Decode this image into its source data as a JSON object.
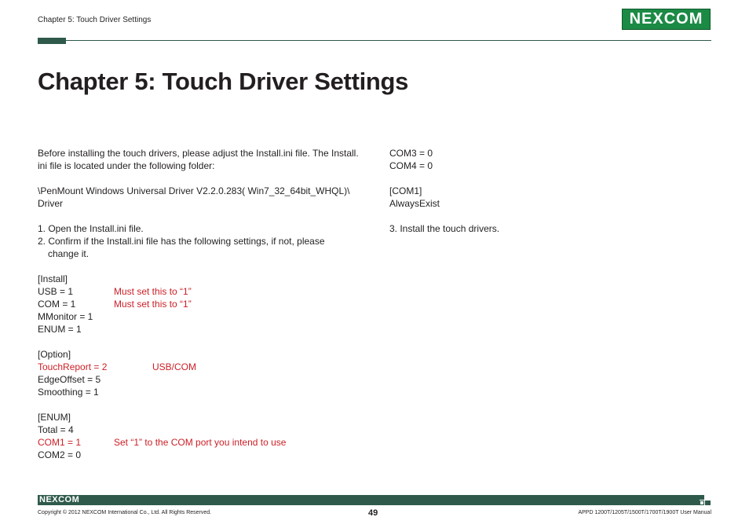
{
  "header": {
    "chapter_label": "Chapter 5: Touch Driver Settings",
    "logo_text": "NEXCOM",
    "brand_green": "#1b8a45",
    "rule_color": "#2f5a4b"
  },
  "title": "Chapter 5: Touch Driver Settings",
  "left": {
    "intro_1": "Before installing the touch drivers, please adjust the Install.ini file. The Install.",
    "intro_2": "ini file is located under the following folder:",
    "path_1": "\\PenMount Windows Universal Driver V2.2.0.283( Win7_32_64bit_WHQL)\\",
    "path_2": "Driver",
    "step_1": "1. Open the Install.ini file.",
    "step_2a": "2. Confirm if the Install.ini file has the following settings, if not, please",
    "step_2b": "change it.",
    "install_header": "[Install]",
    "usb_key": "USB = 1",
    "usb_note": "Must set this to “1”",
    "com_key": "COM = 1",
    "com_note": "Must set this to “1”",
    "mmonitor": "MMonitor = 1",
    "enum_val": "ENUM = 1",
    "option_header": "[Option]",
    "touchreport_key": "TouchReport = 2",
    "touchreport_note": "USB/COM",
    "edgeoffset": "EdgeOffset = 5",
    "smoothing": "Smoothing = 1",
    "enum_header": "[ENUM]",
    "total": "Total = 4",
    "com1_key": "COM1 = 1",
    "com1_note": "Set “1” to the COM port you intend to use",
    "com2": "COM2 = 0"
  },
  "right": {
    "com3": "COM3 = 0",
    "com4": "COM4 = 0",
    "com1_header": "[COM1]",
    "alwaysexist": "AlwaysExist",
    "step_3": "3. Install the touch drivers."
  },
  "footer": {
    "logo_text": "NEXCOM",
    "copyright": "Copyright © 2012 NEXCOM International Co., Ltd. All Rights Reserved.",
    "page_number": "49",
    "manual_title": "APPD 1200T/1205T/1500T/1700T/1900T User Manual"
  },
  "colors": {
    "note_red": "#cc1f26",
    "text": "#231f20"
  }
}
